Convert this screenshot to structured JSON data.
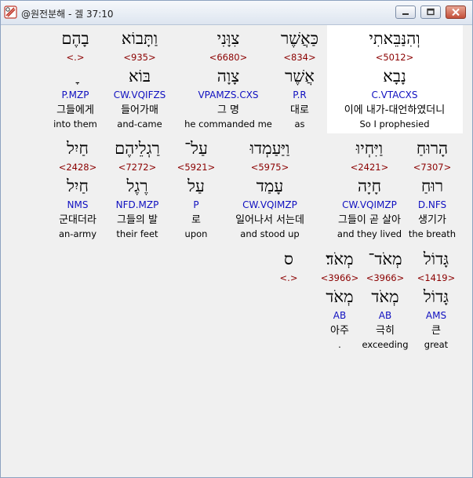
{
  "window": {
    "title": "@원전분해 - 겔 37:10",
    "buttons": {
      "minimize": "minimize-icon",
      "maximize": "maximize-icon",
      "close": "close-icon"
    }
  },
  "rows": [
    [
      {
        "heb": "וְהִנַּבֵּאתִי",
        "num": "<5012>",
        "lemma": "נָבָא",
        "morph": "C.VTACXS",
        "kor": "이에 내가-대언하였더니",
        "eng": "So I prophesied"
      },
      {
        "heb": "כַּאֲשֶׁר",
        "num": "<834>",
        "lemma": "אֲשֶׁר",
        "morph": "P.R",
        "kor": "대로",
        "eng": "as"
      },
      {
        "heb": "צִוָּנִי",
        "num": "<6680>",
        "lemma": "צָוָה",
        "morph": "VPAMZS.CXS",
        "kor": "그 명",
        "eng": "he commanded me"
      },
      {
        "heb": "וַתָּבוֹא",
        "num": "<935>",
        "lemma": "בּוֹא",
        "morph": "CW.VQIFZS",
        "kor": "들어가매",
        "eng": "and-came"
      },
      {
        "heb": "בָהֶם",
        "num": "<.>",
        "lemma": "ׇ",
        "morph": "P.MZP",
        "kor": "그들에게",
        "eng": "into them"
      }
    ],
    [
      {
        "heb": "הָרוּחַ",
        "num": "<7307>",
        "lemma": "רוּחַ",
        "morph": "D.NFS",
        "kor": "생기가",
        "eng": "the breath"
      },
      {
        "heb": "וַיִּחְיוּ",
        "num": "<2421>",
        "lemma": "חָיָה",
        "morph": "CW.VQIMZP",
        "kor": "그들이 곧 살아",
        "eng": "and they lived"
      },
      {
        "heb": "וַיַּעַמְדוּ",
        "num": "<5975>",
        "lemma": "עָמַד",
        "morph": "CW.VQIMZP",
        "kor": "일어나서 서는데",
        "eng": "and stood up"
      },
      {
        "heb": "עַל־",
        "num": "<5921>",
        "lemma": "עַל",
        "morph": "P",
        "kor": "로",
        "eng": "upon"
      },
      {
        "heb": "רַגְלֵיהֶם",
        "num": "<7272>",
        "lemma": "רֶגֶל",
        "morph": "NFD.MZP",
        "kor": "그들의 발",
        "eng": "their feet"
      },
      {
        "heb": "חַיִל",
        "num": "<2428>",
        "lemma": "חַיִל",
        "morph": "NMS",
        "kor": "군대더라",
        "eng": "an-army"
      }
    ],
    [
      {
        "heb": "גָּדוֹל",
        "num": "<1419>",
        "lemma": "גָּדוֹל",
        "morph": "AMS",
        "kor": "큰",
        "eng": "great"
      },
      {
        "heb": "מְאֹד־",
        "num": "<3966>",
        "lemma": "מְאֹד",
        "morph": "AB",
        "kor": "극히",
        "eng": "exceeding"
      },
      {
        "heb": "מְאֹד׃",
        "num": "<3966>",
        "lemma": "מְאֹד",
        "morph": "AB",
        "kor": "아주",
        "eng": "."
      },
      {
        "heb": "ס",
        "num": "<.>",
        "lemma": "",
        "morph": "",
        "kor": "",
        "eng": ""
      }
    ]
  ]
}
